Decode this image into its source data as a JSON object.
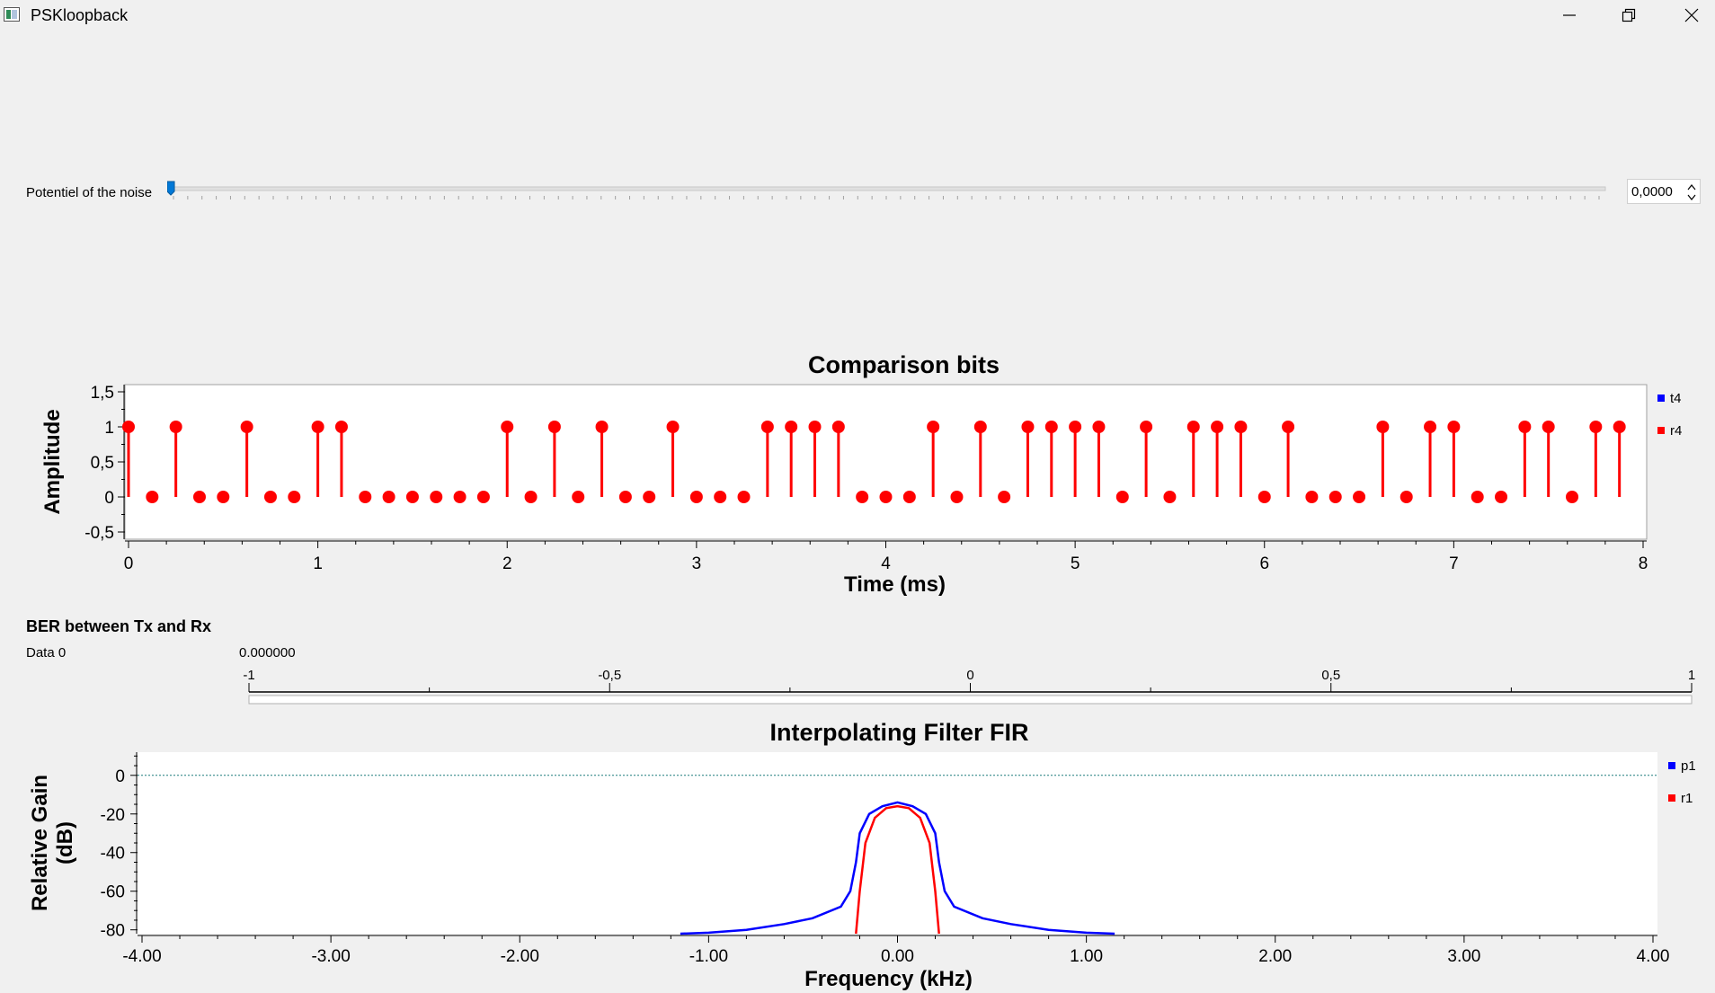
{
  "window": {
    "title": "PSKloopback",
    "controls": [
      "minimize-icon",
      "restore-icon",
      "close-icon"
    ]
  },
  "noise": {
    "label": "Potentiel of the noise",
    "value": "0,0000",
    "slider_fraction": 0.0
  },
  "bits_chart": {
    "type": "scatter",
    "title": "Comparison bits",
    "xlabel": "Time (ms)",
    "ylabel": "Amplitude",
    "x_ticks": [
      "0",
      "1",
      "2",
      "3",
      "4",
      "5",
      "6",
      "7",
      "8"
    ],
    "y_ticks": [
      "1,5",
      "1",
      "0,5",
      "0",
      "-0,5"
    ],
    "xlim": [
      0,
      8
    ],
    "ylim": [
      -0.5,
      1.5
    ],
    "legend": "right",
    "series": [
      {
        "name": "t4",
        "color": "#0000ff",
        "values": []
      },
      {
        "name": "r4",
        "color": "#ff0000",
        "values": [
          1,
          0,
          1,
          0,
          0,
          1,
          0,
          0,
          1,
          1,
          0,
          0,
          0,
          0,
          0,
          0,
          1,
          0,
          1,
          0,
          1,
          0,
          0,
          1,
          0,
          0,
          0,
          1,
          1,
          1,
          1,
          0,
          0,
          0,
          1,
          0,
          1,
          0,
          1,
          1,
          1,
          1,
          0,
          1,
          0,
          1,
          1,
          1,
          0,
          1,
          0,
          0,
          0,
          1,
          0,
          1,
          1,
          0,
          0,
          1,
          1,
          0,
          1,
          1
        ]
      }
    ]
  },
  "ber": {
    "title": "BER between Tx and Rx",
    "row_label": "Data 0",
    "value": "0.000000",
    "scale_labels": [
      "-1",
      "-0,5",
      "0",
      "0,5",
      "1"
    ],
    "range": [
      -1,
      1
    ]
  },
  "fir_chart": {
    "type": "line",
    "title": "Interpolating Filter FIR",
    "xlabel": "Frequency (kHz)",
    "ylabel_lines": [
      "Relative Gain",
      "(dB)"
    ],
    "x_ticks": [
      "-4.00",
      "-3.00",
      "-2.00",
      "-1.00",
      "0.00",
      "1.00",
      "2.00",
      "3.00",
      "4.00"
    ],
    "y_ticks": [
      "0",
      "-20",
      "-40",
      "-60",
      "-80"
    ],
    "xlim": [
      -4,
      4
    ],
    "ylim": [
      -82,
      12
    ],
    "legend": "right",
    "reference_line": 0,
    "series": [
      {
        "name": "p1",
        "color": "#0000ff",
        "points": [
          [
            -1.15,
            -82
          ],
          [
            -1.0,
            -81.5
          ],
          [
            -0.8,
            -80
          ],
          [
            -0.6,
            -77
          ],
          [
            -0.45,
            -74
          ],
          [
            -0.3,
            -68
          ],
          [
            -0.25,
            -60
          ],
          [
            -0.22,
            -45
          ],
          [
            -0.2,
            -30
          ],
          [
            -0.15,
            -20
          ],
          [
            -0.08,
            -16
          ],
          [
            0,
            -14
          ],
          [
            0.08,
            -16
          ],
          [
            0.15,
            -20
          ],
          [
            0.2,
            -30
          ],
          [
            0.22,
            -45
          ],
          [
            0.25,
            -60
          ],
          [
            0.3,
            -68
          ],
          [
            0.45,
            -74
          ],
          [
            0.6,
            -77
          ],
          [
            0.8,
            -80
          ],
          [
            1.0,
            -81.5
          ],
          [
            1.15,
            -82
          ]
        ]
      },
      {
        "name": "r1",
        "color": "#ff0000",
        "points": [
          [
            -0.22,
            -82
          ],
          [
            -0.2,
            -60
          ],
          [
            -0.17,
            -35
          ],
          [
            -0.12,
            -22
          ],
          [
            -0.06,
            -17
          ],
          [
            0,
            -16
          ],
          [
            0.06,
            -17
          ],
          [
            0.12,
            -22
          ],
          [
            0.17,
            -35
          ],
          [
            0.2,
            -60
          ],
          [
            0.22,
            -82
          ]
        ]
      }
    ]
  }
}
